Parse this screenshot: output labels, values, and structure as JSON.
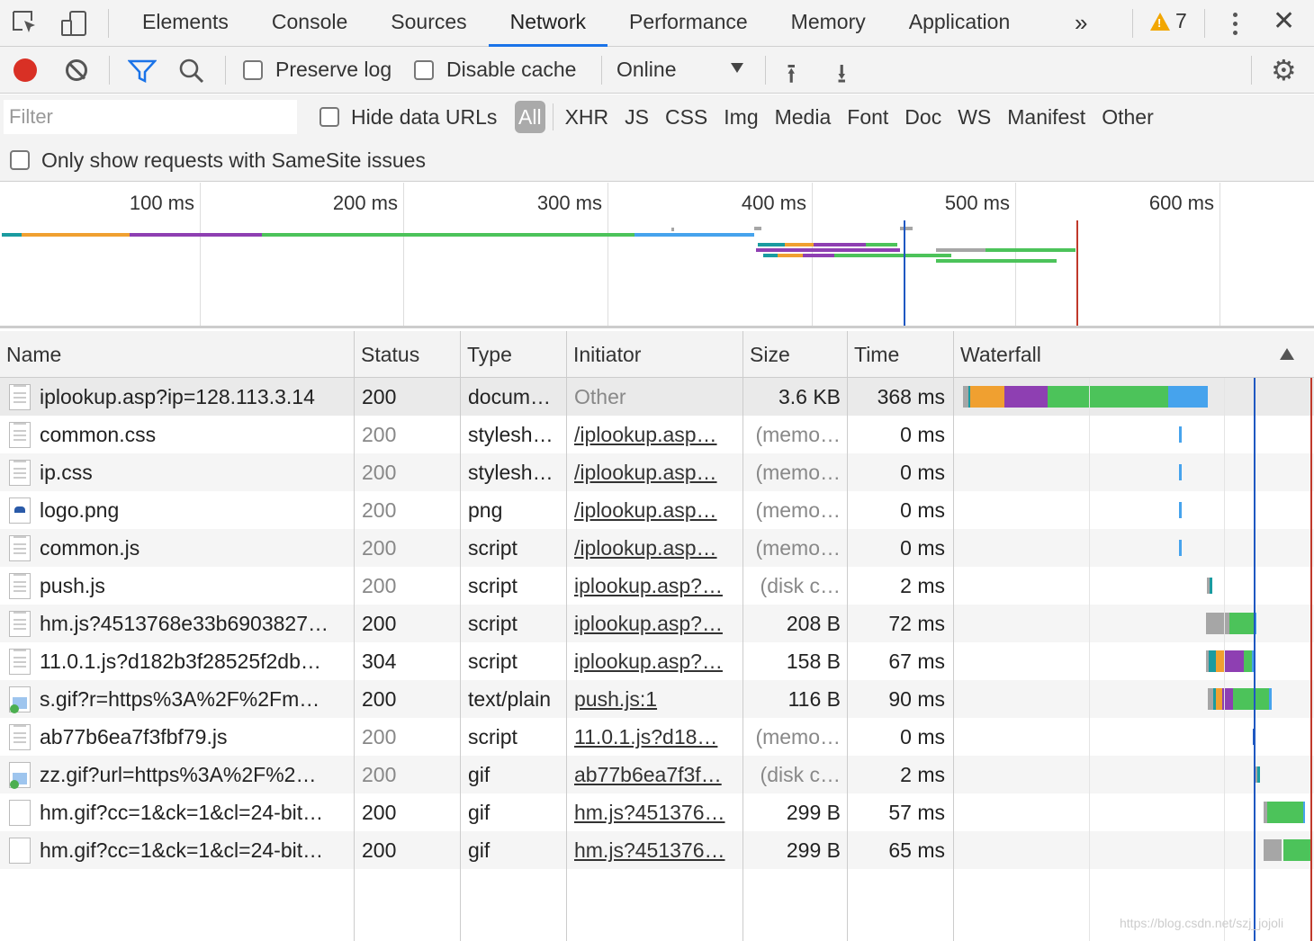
{
  "tabs": [
    {
      "label": "Elements",
      "active": false
    },
    {
      "label": "Console",
      "active": false
    },
    {
      "label": "Sources",
      "active": false
    },
    {
      "label": "Network",
      "active": true
    },
    {
      "label": "Performance",
      "active": false
    },
    {
      "label": "Memory",
      "active": false
    },
    {
      "label": "Application",
      "active": false
    }
  ],
  "tabbar": {
    "more_label": "»",
    "warnings_count": "7",
    "warning_glyph": "!",
    "close_label": "✕"
  },
  "toolbar": {
    "preserve_log_label": "Preserve log",
    "disable_cache_label": "Disable cache",
    "throttling_value": "Online",
    "settings_glyph": "⚙",
    "upload_glyph": "⭱",
    "download_glyph": "⭳"
  },
  "filter": {
    "placeholder": "Filter",
    "hide_data_urls_label": "Hide data URLs",
    "types": [
      "All",
      "XHR",
      "JS",
      "CSS",
      "Img",
      "Media",
      "Font",
      "Doc",
      "WS",
      "Manifest",
      "Other"
    ],
    "samesite_label": "Only show requests with SameSite issues"
  },
  "overview": {
    "ticks": [
      "100 ms",
      "200 ms",
      "300 ms",
      "400 ms",
      "500 ms",
      "600 ms"
    ]
  },
  "table": {
    "columns": [
      "Name",
      "Status",
      "Type",
      "Initiator",
      "Size",
      "Time",
      "Waterfall"
    ],
    "sort_column": "Waterfall",
    "rows": [
      {
        "icon": "doc",
        "name": "iplookup.asp?ip=128.113.3.14",
        "status": "200",
        "type": "docum…",
        "initiator": "Other",
        "size": "3.6 KB",
        "time": "368 ms",
        "status_grey": false,
        "size_grey": false
      },
      {
        "icon": "doc",
        "name": "common.css",
        "status": "200",
        "type": "stylesh…",
        "initiator": "/iplookup.asp…",
        "size": "(memo…",
        "time": "0 ms",
        "status_grey": true,
        "size_grey": true
      },
      {
        "icon": "doc",
        "name": "ip.css",
        "status": "200",
        "type": "stylesh…",
        "initiator": "/iplookup.asp…",
        "size": "(memo…",
        "time": "0 ms",
        "status_grey": true,
        "size_grey": true
      },
      {
        "icon": "logo",
        "name": "logo.png",
        "status": "200",
        "type": "png",
        "initiator": "/iplookup.asp…",
        "size": "(memo…",
        "time": "0 ms",
        "status_grey": true,
        "size_grey": true
      },
      {
        "icon": "doc",
        "name": "common.js",
        "status": "200",
        "type": "script",
        "initiator": "/iplookup.asp…",
        "size": "(memo…",
        "time": "0 ms",
        "status_grey": true,
        "size_grey": true
      },
      {
        "icon": "doc",
        "name": "push.js",
        "status": "200",
        "type": "script",
        "initiator": "iplookup.asp?…",
        "size": "(disk c…",
        "time": "2 ms",
        "status_grey": true,
        "size_grey": true
      },
      {
        "icon": "doc",
        "name": "hm.js?4513768e33b6903827…",
        "status": "200",
        "type": "script",
        "initiator": "iplookup.asp?…",
        "size": "208 B",
        "time": "72 ms",
        "status_grey": false,
        "size_grey": false
      },
      {
        "icon": "doc",
        "name": "11.0.1.js?d182b3f28525f2db…",
        "status": "304",
        "type": "script",
        "initiator": "iplookup.asp?…",
        "size": "158 B",
        "time": "67 ms",
        "status_grey": false,
        "size_grey": false
      },
      {
        "icon": "img",
        "name": "s.gif?r=https%3A%2F%2Fm…",
        "status": "200",
        "type": "text/plain",
        "initiator": "push.js:1",
        "size": "116 B",
        "time": "90 ms",
        "status_grey": false,
        "size_grey": false
      },
      {
        "icon": "doc",
        "name": "ab77b6ea7f3fbf79.js",
        "status": "200",
        "type": "script",
        "initiator": "11.0.1.js?d18…",
        "size": "(memo…",
        "time": "0 ms",
        "status_grey": true,
        "size_grey": true
      },
      {
        "icon": "img",
        "name": "zz.gif?url=https%3A%2F%2…",
        "status": "200",
        "type": "gif",
        "initiator": "ab77b6ea7f3f…",
        "size": "(disk c…",
        "time": "2 ms",
        "status_grey": true,
        "size_grey": true
      },
      {
        "icon": "blank",
        "name": "hm.gif?cc=1&ck=1&cl=24-bit…",
        "status": "200",
        "type": "gif",
        "initiator": "hm.js?451376…",
        "size": "299 B",
        "time": "57 ms",
        "status_grey": false,
        "size_grey": false
      },
      {
        "icon": "blank",
        "name": "hm.gif?cc=1&ck=1&cl=24-bit…",
        "status": "200",
        "type": "gif",
        "initiator": "hm.js?451376…",
        "size": "299 B",
        "time": "65 ms",
        "status_grey": false,
        "size_grey": false
      }
    ]
  },
  "colors": {
    "queue": "#a6a6a6",
    "stalled": "#1a9ba0",
    "dns": "#f0a030",
    "connect": "#8e3fb2",
    "waiting": "#4cc35a",
    "download": "#46a3ed",
    "domcontentloaded": "#1f58c2",
    "load": "#c0392b",
    "record": "#d93025",
    "accent": "#1a73e8"
  },
  "watermark": "https://blog.csdn.net/szj_jojoli"
}
